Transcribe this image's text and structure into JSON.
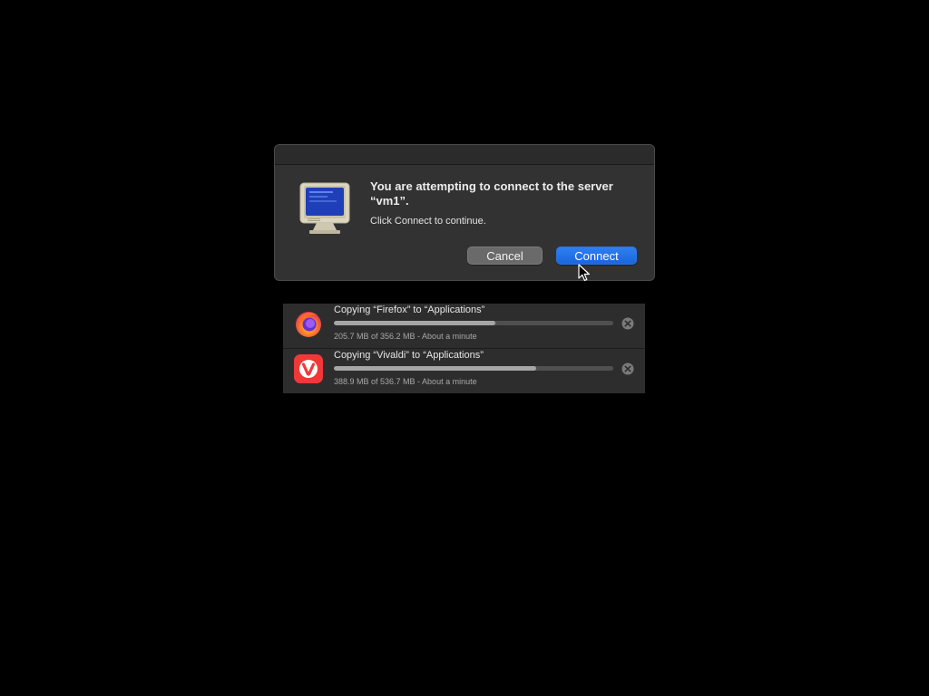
{
  "dialog": {
    "title": "You are attempting to connect to the server “vm1”.",
    "message": "Click Connect to continue.",
    "icon": "screen-sharing-monitor-icon",
    "buttons": {
      "cancel_label": "Cancel",
      "connect_label": "Connect"
    },
    "accent_color": "#1f6fe5"
  },
  "copy_panel": {
    "items": [
      {
        "title": "Copying “Firefox” to “Applications”",
        "status": "205.7 MB of 356.2 MB - About a minute",
        "progress": 0.577,
        "icon": "firefox-icon"
      },
      {
        "title": "Copying “Vivaldi” to “Applications”",
        "status": "388.9 MB of 536.7 MB - About a minute",
        "progress": 0.725,
        "icon": "vivaldi-icon"
      }
    ]
  }
}
